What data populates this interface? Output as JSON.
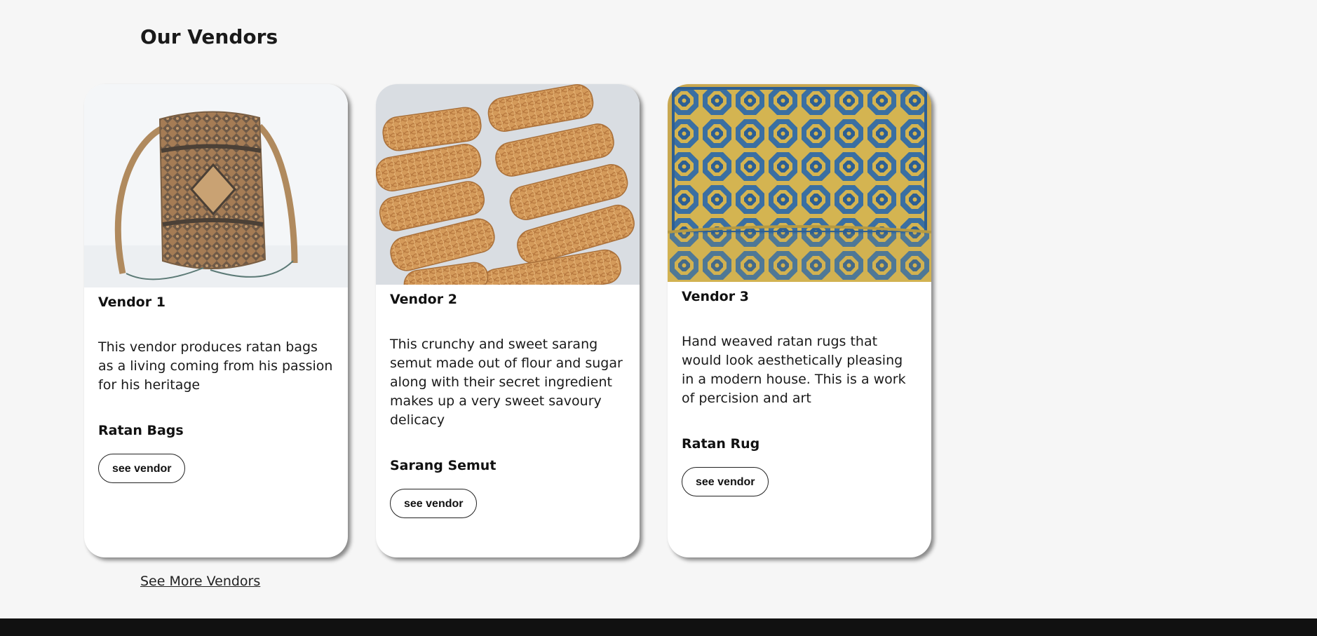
{
  "section": {
    "title": "Our Vendors"
  },
  "vendors": [
    {
      "name": "Vendor 1",
      "description": "This vendor produces ratan bags as a living coming from his passion for his heritage",
      "product": "Ratan Bags",
      "button_label": "see vendor",
      "image_icon": "rattan-bag-photo"
    },
    {
      "name": "Vendor 2",
      "description": "This crunchy and sweet sarang semut made out of flour and sugar along with their secret ingredient makes up a very sweet savoury delicacy",
      "product": "Sarang Semut",
      "button_label": "see vendor",
      "image_icon": "sarang-semut-photo"
    },
    {
      "name": "Vendor 3",
      "description": "Hand weaved ratan rugs that would look aesthetically pleasing in a modern house. This is a work of percision and art",
      "product": "Ratan Rug",
      "button_label": "see vendor",
      "image_icon": "rattan-rug-photo"
    }
  ],
  "see_more": {
    "label": "See More Vendors"
  },
  "colors": {
    "background": "#f6f6f6",
    "card": "#ffffff",
    "footer": "#111111"
  }
}
